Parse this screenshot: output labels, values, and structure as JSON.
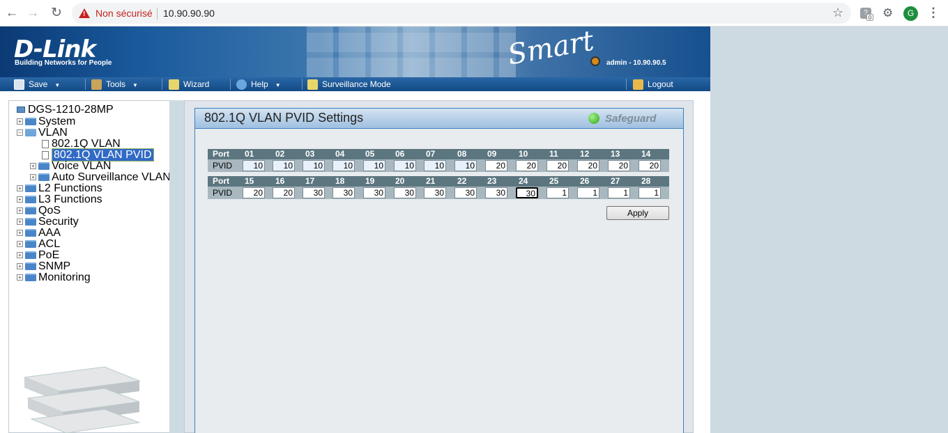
{
  "browser": {
    "security_label": "Non sécurisé",
    "url": "10.90.90.90",
    "profile_initial": "G",
    "ext_badge": "0"
  },
  "banner": {
    "brand": "D-Link",
    "tagline": "Building Networks for People",
    "product": "Smart",
    "user": "admin - 10.90.90.5"
  },
  "toolbar": {
    "save": "Save",
    "tools": "Tools",
    "wizard": "Wizard",
    "help": "Help",
    "surveillance": "Surveillance Mode",
    "logout": "Logout"
  },
  "tree": {
    "root": "DGS-1210-28MP",
    "items": {
      "system": "System",
      "vlan": "VLAN",
      "vlan_8021q": "802.1Q VLAN",
      "vlan_pvid": "802.1Q VLAN PVID",
      "voice_vlan": "Voice VLAN",
      "auto_surv_vlan": "Auto Surveillance VLAN",
      "l2": "L2 Functions",
      "l3": "L3 Functions",
      "qos": "QoS",
      "security": "Security",
      "aaa": "AAA",
      "acl": "ACL",
      "poe": "PoE",
      "snmp": "SNMP",
      "monitoring": "Monitoring"
    }
  },
  "panel": {
    "title": "802.1Q VLAN PVID Settings",
    "safeguard": "Safeguard",
    "port_label": "Port",
    "pvid_label": "PVID",
    "apply": "Apply"
  },
  "ports_row1": [
    "01",
    "02",
    "03",
    "04",
    "05",
    "06",
    "07",
    "08",
    "09",
    "10",
    "11",
    "12",
    "13",
    "14"
  ],
  "pvids_row1": [
    "10",
    "10",
    "10",
    "10",
    "10",
    "10",
    "10",
    "10",
    "20",
    "20",
    "20",
    "20",
    "20",
    "20"
  ],
  "ports_row2": [
    "15",
    "16",
    "17",
    "18",
    "19",
    "20",
    "21",
    "22",
    "23",
    "24",
    "25",
    "26",
    "27",
    "28"
  ],
  "pvids_row2": [
    "20",
    "20",
    "30",
    "30",
    "30",
    "30",
    "30",
    "30",
    "30",
    "30",
    "1",
    "1",
    "1",
    "1"
  ]
}
